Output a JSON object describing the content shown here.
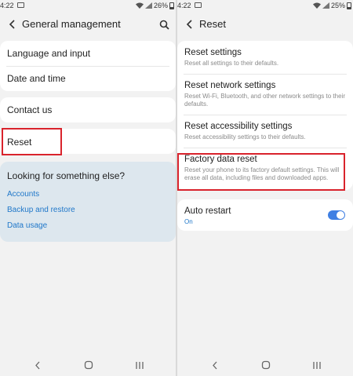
{
  "status_left": {
    "time": "4:22",
    "battery": "26%"
  },
  "status_right": {
    "time": "4:22",
    "battery": "25%"
  },
  "left_screen": {
    "title": "General management",
    "items": [
      "Language and input",
      "Date and time",
      "Contact us",
      "Reset"
    ],
    "help": {
      "title": "Looking for something else?",
      "links": [
        "Accounts",
        "Backup and restore",
        "Data usage"
      ]
    }
  },
  "right_screen": {
    "title": "Reset",
    "items": [
      {
        "title": "Reset settings",
        "desc": "Reset all settings to their defaults."
      },
      {
        "title": "Reset network settings",
        "desc": "Reset Wi-Fi, Bluetooth, and other network settings to their defaults."
      },
      {
        "title": "Reset accessibility settings",
        "desc": "Reset accessibility settings to their defaults."
      },
      {
        "title": "Factory data reset",
        "desc": "Reset your phone to its factory default settings. This will erase all data, including files and downloaded apps."
      }
    ],
    "auto_restart": {
      "title": "Auto restart",
      "state": "On",
      "enabled": true
    }
  },
  "colors": {
    "accent": "#1f77c9",
    "highlight": "#d9232c",
    "toggle": "#3f7fe3"
  },
  "icons": {
    "back": "chevron-left-icon",
    "search": "search-icon",
    "nav_back": "nav-back-icon",
    "nav_home": "nav-home-icon",
    "nav_recents": "nav-recents-icon"
  }
}
